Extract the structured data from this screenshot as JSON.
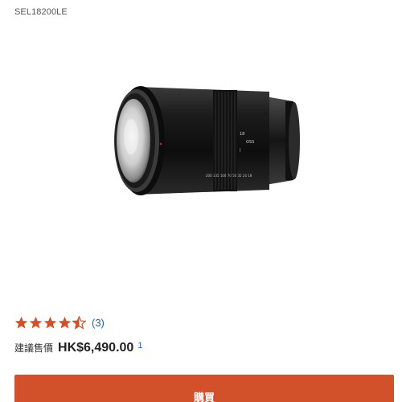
{
  "product": {
    "model_code": "SEL18200LE",
    "image_icon": "camera-lens-image"
  },
  "rating": {
    "stars": 4.5,
    "max_stars": 5,
    "star_color": "#d2512a",
    "review_count_label": "(3)"
  },
  "price": {
    "label": "建議售價",
    "value": "HK$6,490.00",
    "footnote": "1"
  },
  "buy_button": {
    "label": "購買",
    "color": "#d2512a"
  }
}
